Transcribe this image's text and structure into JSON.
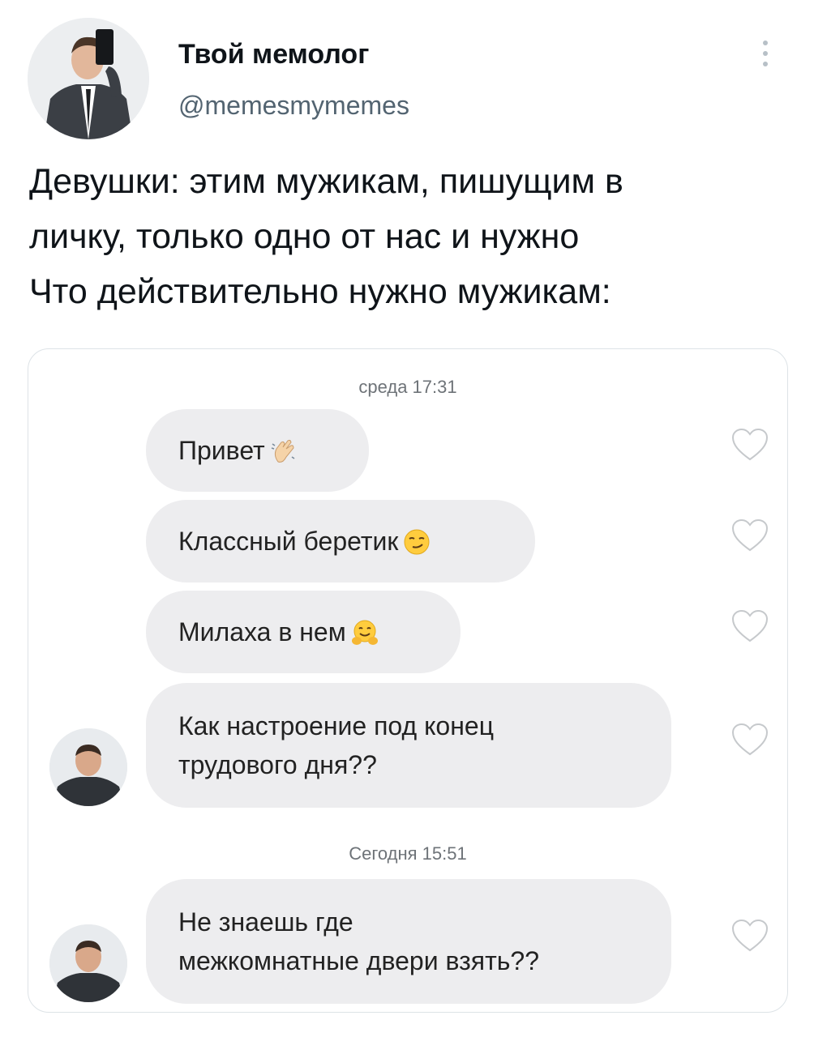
{
  "tweet": {
    "author_name": "Твой мемолог",
    "author_handle": "@memesmymemes",
    "text_lines": [
      "Девушки: этим мужикам, пишущим в",
      "личку, только одно от нас и нужно",
      "Что действительно нужно мужикам:"
    ]
  },
  "chat": {
    "date_separators": [
      "среда 17:31",
      "Сегодня 15:51"
    ],
    "messages": [
      {
        "text": "Привет",
        "emoji": "waving-hand-icon"
      },
      {
        "text": "Классный беретик",
        "emoji": "smirking-face-icon"
      },
      {
        "text": "Милаха в нем",
        "emoji": "hugging-face-icon"
      },
      {
        "text": "Как настроение под конец\nтрудового дня??"
      },
      {
        "text": "Не знаешь где\nмежкомнатные двери взять??"
      }
    ]
  },
  "colors": {
    "bubble": "#ededef",
    "handle": "#536471",
    "heart_outline": "#c6c9cc"
  }
}
